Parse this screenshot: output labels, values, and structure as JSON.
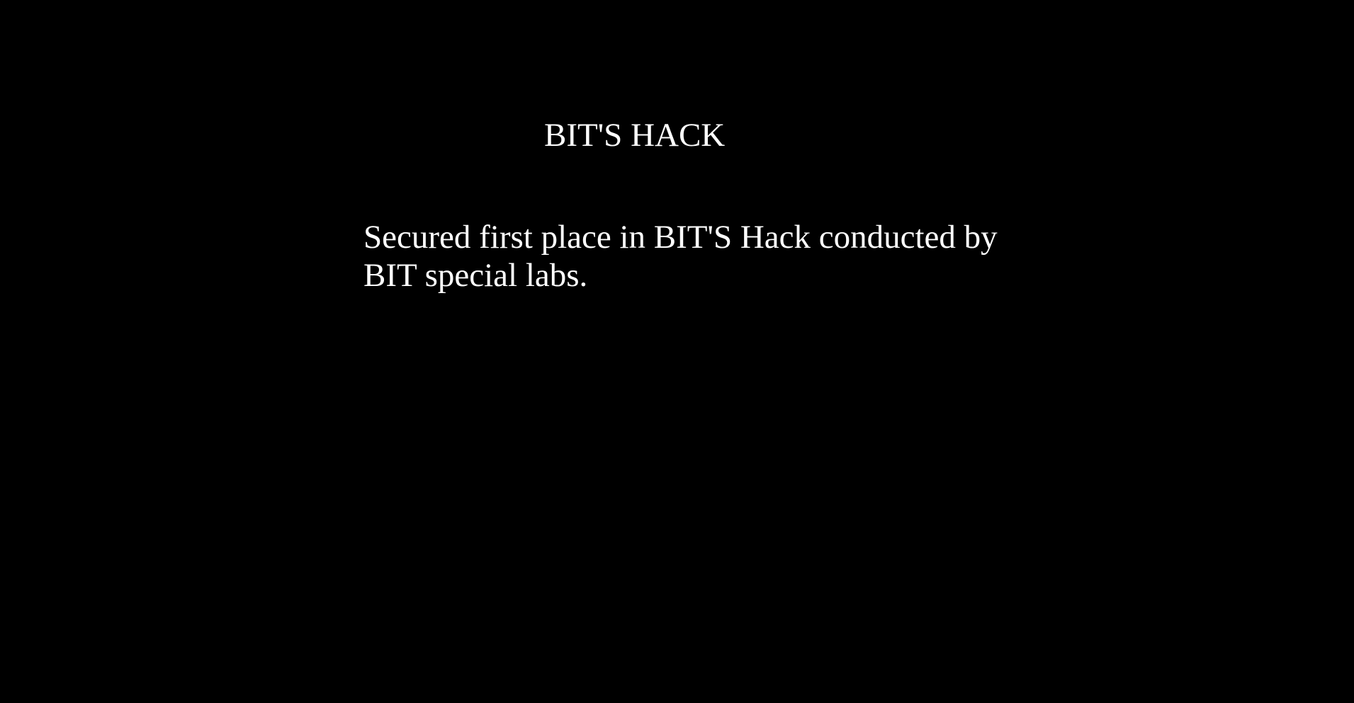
{
  "card": {
    "title": "BIT'S HACK",
    "description": "Secured first place in BIT'S Hack conducted by BIT special labs."
  },
  "colors": {
    "background": "#000000",
    "text": "#ffffff"
  }
}
